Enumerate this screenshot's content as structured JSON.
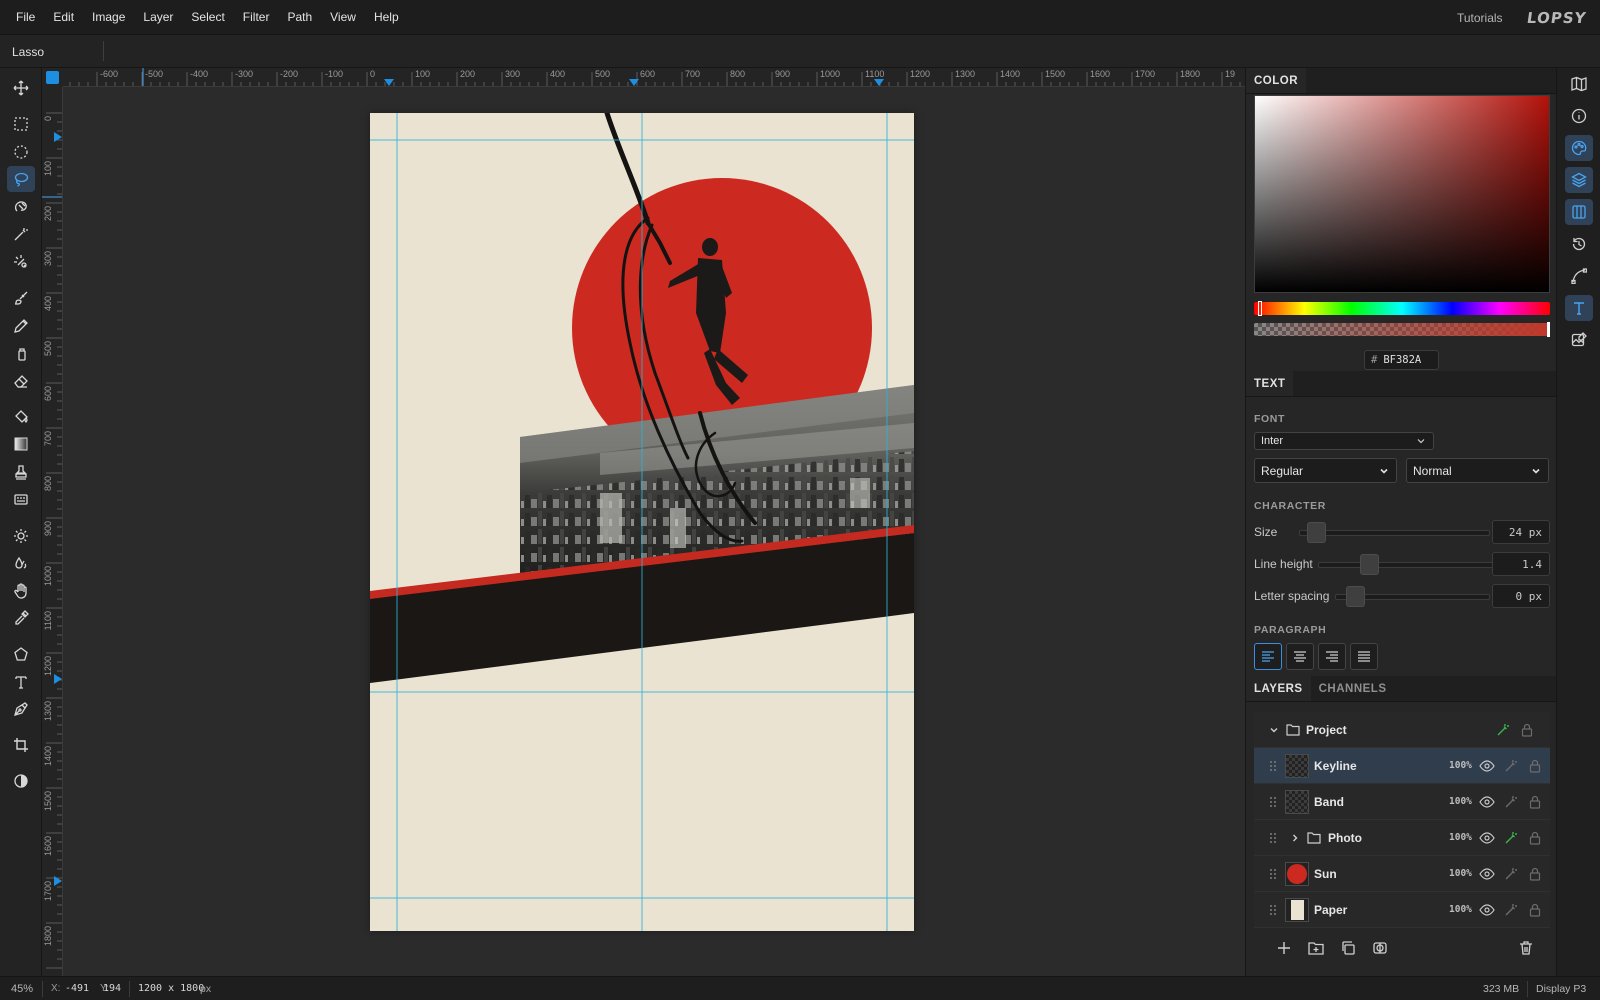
{
  "menubar": {
    "items": [
      "File",
      "Edit",
      "Image",
      "Layer",
      "Select",
      "Filter",
      "Path",
      "View",
      "Help"
    ],
    "tutorials": "Tutorials",
    "logo": "LOPSY"
  },
  "options_bar": {
    "tool_name": "Lasso"
  },
  "toolbox": {
    "active_tool": "lasso-tool",
    "tools": [
      "move-tool",
      "rect-select-tool",
      "ellipse-select-tool",
      "lasso-tool",
      "magnetic-lasso-tool",
      "magic-wand-tool",
      "quick-select-tool",
      "brush-tool",
      "pencil-tool",
      "spray-tool",
      "eraser-tool",
      "fill-tool",
      "gradient-tool",
      "stamp-tool",
      "pattern-tool",
      "dodge-tool",
      "blur-tool",
      "hand-tool",
      "eyedropper-tool",
      "shape-tool",
      "text-tool",
      "pen-tool",
      "crop-tool",
      "contrast-tool"
    ]
  },
  "rulers": {
    "top_labels": [
      "-600",
      "-500",
      "-400",
      "-300",
      "-200",
      "-100",
      "0",
      "100",
      "200",
      "300",
      "400",
      "500",
      "600",
      "700",
      "800",
      "900",
      "1000",
      "1100",
      "1200",
      "1300",
      "1400",
      "1500",
      "1600",
      "1700",
      "1800",
      "19"
    ],
    "left_labels": [
      "0",
      "100",
      "200",
      "300",
      "400",
      "500",
      "600",
      "700",
      "800",
      "900",
      "1000",
      "1100",
      "1200",
      "1300",
      "1400",
      "1500",
      "1600",
      "1700",
      "1800"
    ]
  },
  "color_panel": {
    "title": "COLOR",
    "hex_prefix": "#",
    "hex": "BF382A",
    "current_color": "#bf382a",
    "hue_base": "#b3110a"
  },
  "text_panel": {
    "title": "TEXT",
    "font_label": "FONT",
    "font_family": "Inter",
    "font_style": "Regular",
    "font_variant": "Normal",
    "character_label": "CHARACTER",
    "size_label": "Size",
    "size_value": "24 px",
    "line_height_label": "Line height",
    "line_height_value": "1.4",
    "letter_spacing_label": "Letter spacing",
    "letter_spacing_value": "0 px",
    "paragraph_label": "PARAGRAPH",
    "alignment": "left"
  },
  "layers_panel": {
    "tabs": [
      "LAYERS",
      "CHANNELS"
    ],
    "active_tab": "LAYERS",
    "group": {
      "name": "Project",
      "expanded": true
    },
    "layers": [
      {
        "name": "Keyline",
        "opacity": "100%",
        "thumb": "transparent",
        "selected": true,
        "is_group": false
      },
      {
        "name": "Band",
        "opacity": "100%",
        "thumb": "transparent",
        "selected": false,
        "is_group": false
      },
      {
        "name": "Photo",
        "opacity": "100%",
        "thumb": "folder",
        "selected": false,
        "is_group": true
      },
      {
        "name": "Sun",
        "opacity": "100%",
        "thumb": "sun",
        "selected": false,
        "is_group": false
      },
      {
        "name": "Paper",
        "opacity": "100%",
        "thumb": "paper",
        "selected": false,
        "is_group": false
      }
    ]
  },
  "right_bar": {
    "buttons": [
      "map-icon",
      "info-icon",
      "palette-icon",
      "layers-icon",
      "columns-icon",
      "history-icon",
      "path-icon",
      "text-icon",
      "image-edit-icon"
    ],
    "active": [
      "palette-icon",
      "layers-icon",
      "columns-icon",
      "text-icon"
    ]
  },
  "statusbar": {
    "zoom": "45%",
    "x_label": "X:",
    "x_value": "-491",
    "y_label": "Y:",
    "y_value": "194",
    "doc_size": "1200 x 1800",
    "doc_unit": "px",
    "memory": "323 MB",
    "color_profile": "Display P3"
  },
  "document": {
    "paper_color": "#ebe3d2",
    "sun_color": "#cc2a20",
    "band_color": "#1a1714",
    "accent_line": "#c42a1f",
    "guide_color": "#28b4d8"
  }
}
